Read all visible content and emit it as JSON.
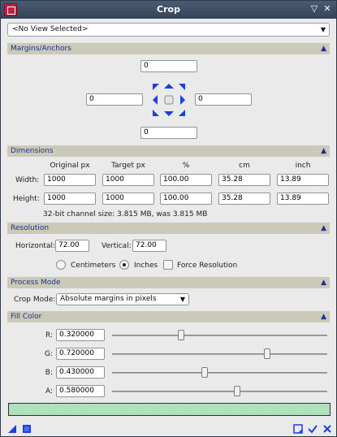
{
  "window": {
    "title": "Crop"
  },
  "view_selector": {
    "value": "<No View Selected>"
  },
  "margins": {
    "title": "Margins/Anchors",
    "top": "0",
    "left": "0",
    "right": "0",
    "bottom": "0"
  },
  "dimensions": {
    "title": "Dimensions",
    "columns": [
      "Original px",
      "Target px",
      "%",
      "cm",
      "inch"
    ],
    "width": {
      "label": "Width:",
      "original_px": "1000",
      "target_px": "1000",
      "percent": "100.00",
      "cm": "35.28",
      "inch": "13.89"
    },
    "height": {
      "label": "Height:",
      "original_px": "1000",
      "target_px": "1000",
      "percent": "100.00",
      "cm": "35.28",
      "inch": "13.89"
    },
    "info": "32-bit channel size: 3.815 MB, was 3.815 MB"
  },
  "resolution": {
    "title": "Resolution",
    "horizontal_label": "Horizontal:",
    "horizontal": "72.00",
    "vertical_label": "Vertical:",
    "vertical": "72.00",
    "units": [
      {
        "label": "Centimeters",
        "selected": false
      },
      {
        "label": "Inches",
        "selected": true
      }
    ],
    "force_label": "Force Resolution",
    "force_checked": false
  },
  "process_mode": {
    "title": "Process Mode",
    "crop_mode_label": "Crop Mode:",
    "crop_mode": "Absolute margins in pixels"
  },
  "fill_color": {
    "title": "Fill Color",
    "channels": [
      {
        "label": "R:",
        "value": "0.320000",
        "level": 0.32
      },
      {
        "label": "G:",
        "value": "0.720000",
        "level": 0.72
      },
      {
        "label": "B:",
        "value": "0.430000",
        "level": 0.43
      },
      {
        "label": "A:",
        "value": "0.580000",
        "level": 0.58
      }
    ],
    "swatch_color": "#a6dcb6"
  },
  "colors": {
    "accent": "#19318f",
    "section_bg": "#cbcab9",
    "anchor_blue": "#1a3fe8"
  }
}
